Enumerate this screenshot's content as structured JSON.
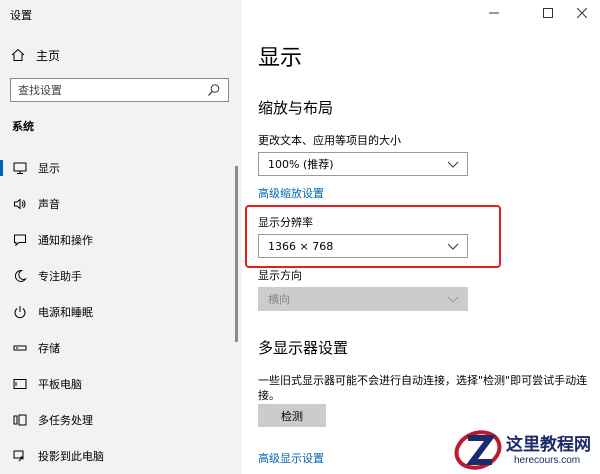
{
  "window": {
    "title": "设置",
    "controls": [
      "minimize",
      "maximize",
      "close"
    ]
  },
  "sidebar": {
    "home_label": "主页",
    "search_placeholder": "查找设置",
    "section_label": "系统",
    "items": [
      {
        "label": "显示",
        "icon": "monitor-icon",
        "active": true
      },
      {
        "label": "声音",
        "icon": "speaker-icon"
      },
      {
        "label": "通知和操作",
        "icon": "notification-icon"
      },
      {
        "label": "专注助手",
        "icon": "moon-icon"
      },
      {
        "label": "电源和睡眠",
        "icon": "power-icon"
      },
      {
        "label": "存储",
        "icon": "storage-icon"
      },
      {
        "label": "平板电脑",
        "icon": "tablet-icon"
      },
      {
        "label": "多任务处理",
        "icon": "multitask-icon"
      },
      {
        "label": "投影到此电脑",
        "icon": "project-icon"
      }
    ]
  },
  "main": {
    "title": "显示",
    "scale_layout": {
      "heading": "缩放与布局",
      "text_size_label": "更改文本、应用等项目的大小",
      "text_size_value": "100% (推荐)",
      "advanced_link": "高级缩放设置",
      "resolution_label": "显示分辨率",
      "resolution_value": "1366 × 768",
      "orientation_label": "显示方向",
      "orientation_value": "横向"
    },
    "multi_display": {
      "heading": "多显示器设置",
      "description": "一些旧式显示器可能不会进行自动连接，选择\"检测\"即可尝试手动连接。",
      "detect_button": "检测",
      "advanced_link": "高级显示设置"
    }
  },
  "watermark": {
    "name": "这里教程网",
    "url": "herecours.com"
  },
  "colors": {
    "accent": "#0063b1",
    "link": "#0066b4",
    "highlight": "#e02020",
    "sidebar_bg": "#f2f2f2"
  }
}
